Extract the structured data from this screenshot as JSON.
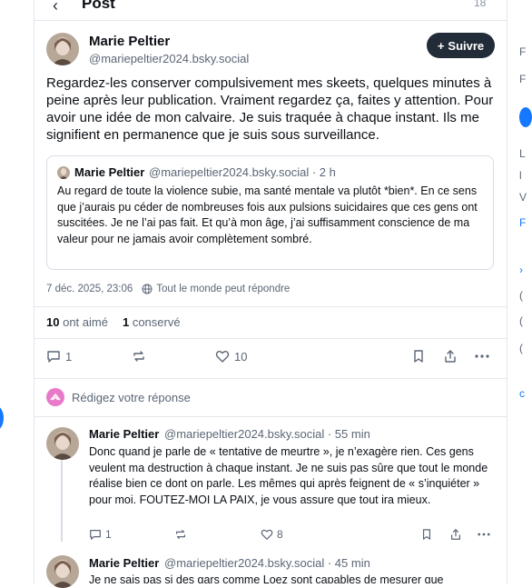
{
  "header": {
    "title": "Post",
    "count": "18"
  },
  "post": {
    "author_name": "Marie Peltier",
    "author_handle": "@mariepeltier2024.bsky.social",
    "follow_label": "Suivre",
    "text": "Regardez-les conserver compulsivement mes skeets, quelques minutes à peine après leur publication. Vraiment regardez ça, faites y attention. Pour avoir une idée de mon calvaire. Je suis traquée à chaque instant. Ils me signifient en permanence que je suis sous surveillance.",
    "quote": {
      "author_name": "Marie Peltier",
      "author_handle": "@mariepeltier2024.bsky.social · 2 h",
      "text": "Au regard de toute la violence subie, ma santé mentale va plutôt *bien*. En ce sens que j’aurais pu céder de nombreuses fois aux pulsions suicidaires que ces gens ont suscitées. Je ne l’ai pas fait. Et qu’à mon âge, j’ai suffisamment conscience de ma valeur pour ne jamais avoir complètement sombré."
    },
    "timestamp": "7 déc. 2025, 23:06",
    "reply_setting": "Tout le monde peut répondre",
    "likes_count": "10",
    "likes_label": "ont aimé",
    "saves_count": "1",
    "saves_label": "conservé",
    "reply_count": "1",
    "like_count_action": "10"
  },
  "reply_prompt": "Rédigez votre réponse",
  "replies": [
    {
      "author_name": "Marie Peltier",
      "author_handle": "@mariepeltier2024.bsky.social · 55 min",
      "text": "Donc quand je parle de « tentative de meurtre », je n’exagère rien. Ces gens veulent ma destruction à chaque instant. Je ne suis pas sûre que tout le monde réalise bien ce dont on parle. Les mêmes qui après feignent de « s’inquiéter » pour moi. FOUTEZ-MOI LA PAIX, je vous assure que tout ira mieux.",
      "reply_count": "1",
      "like_count": "8"
    },
    {
      "author_name": "Marie Peltier",
      "author_handle": "@mariepeltier2024.bsky.social · 45 min",
      "text": "Je ne sais pas si des gars comme Loez sont capables de mesurer que"
    }
  ],
  "icons": [
    "back-icon",
    "plus-icon",
    "globe-icon",
    "reply-icon",
    "repost-icon",
    "heart-icon",
    "bookmark-icon",
    "share-icon",
    "more-icon"
  ]
}
